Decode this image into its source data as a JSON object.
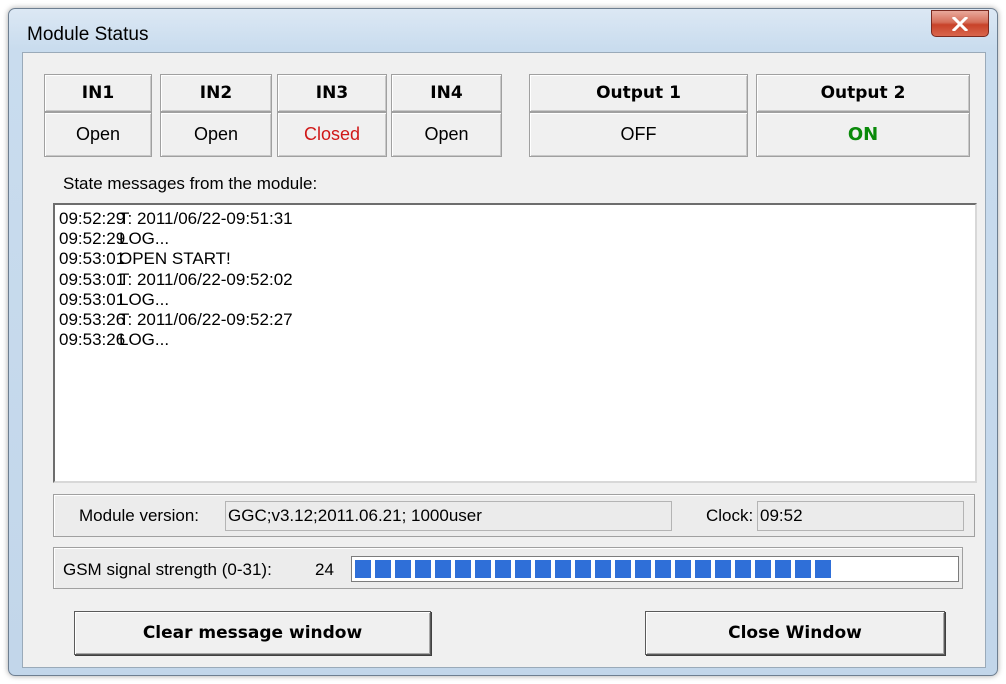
{
  "window": {
    "title": "Module Status",
    "close_glyph": "✕"
  },
  "inputs": [
    {
      "label": "IN1",
      "state": "Open"
    },
    {
      "label": "IN2",
      "state": "Open"
    },
    {
      "label": "IN3",
      "state": "Closed"
    },
    {
      "label": "IN4",
      "state": "Open"
    }
  ],
  "outputs": [
    {
      "label": "Output 1",
      "state": "OFF"
    },
    {
      "label": "Output 2",
      "state": "ON"
    }
  ],
  "messages": {
    "label": "State messages from the module:",
    "lines": [
      {
        "time": "09:52:29",
        "text": "T: 2011/06/22-09:51:31"
      },
      {
        "time": "09:52:29",
        "text": "LOG..."
      },
      {
        "time": "09:53:01",
        "text": "OPEN START!"
      },
      {
        "time": "09:53:01",
        "text": "T: 2011/06/22-09:52:02"
      },
      {
        "time": "09:53:01",
        "text": "LOG..."
      },
      {
        "time": "09:53:26",
        "text": "T: 2011/06/22-09:52:27"
      },
      {
        "time": "09:53:26",
        "text": "LOG..."
      }
    ]
  },
  "info": {
    "version_label": "Module version:",
    "version_value": "GGC;v3.12;2011.06.21; 1000user",
    "clock_label": "Clock:",
    "clock_value": "09:52"
  },
  "signal": {
    "label": "GSM signal strength (0-31):",
    "value": "24",
    "max": 31,
    "bar_color": "#2f6fd8"
  },
  "buttons": {
    "clear": "Clear message window",
    "close": "Close Window"
  },
  "colors": {
    "closed_state": "#d01818",
    "on_state": "#0a8a0a"
  }
}
